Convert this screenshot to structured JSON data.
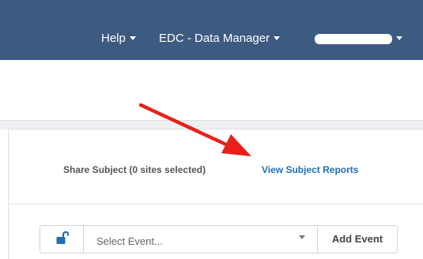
{
  "navbar": {
    "help_label": "Help",
    "role_label": "EDC - Data Manager",
    "user_label": ""
  },
  "subject": {
    "share_label": "Share Subject (0 sites selected)",
    "reports_label": "View Subject Reports"
  },
  "event": {
    "lock_icon": "unlock-icon",
    "select_placeholder": "Select Event...",
    "add_label": "Add Event"
  },
  "colors": {
    "navbar": "#3d5a80",
    "link": "#1f6fb5",
    "annotation_arrow": "#e8201c"
  }
}
